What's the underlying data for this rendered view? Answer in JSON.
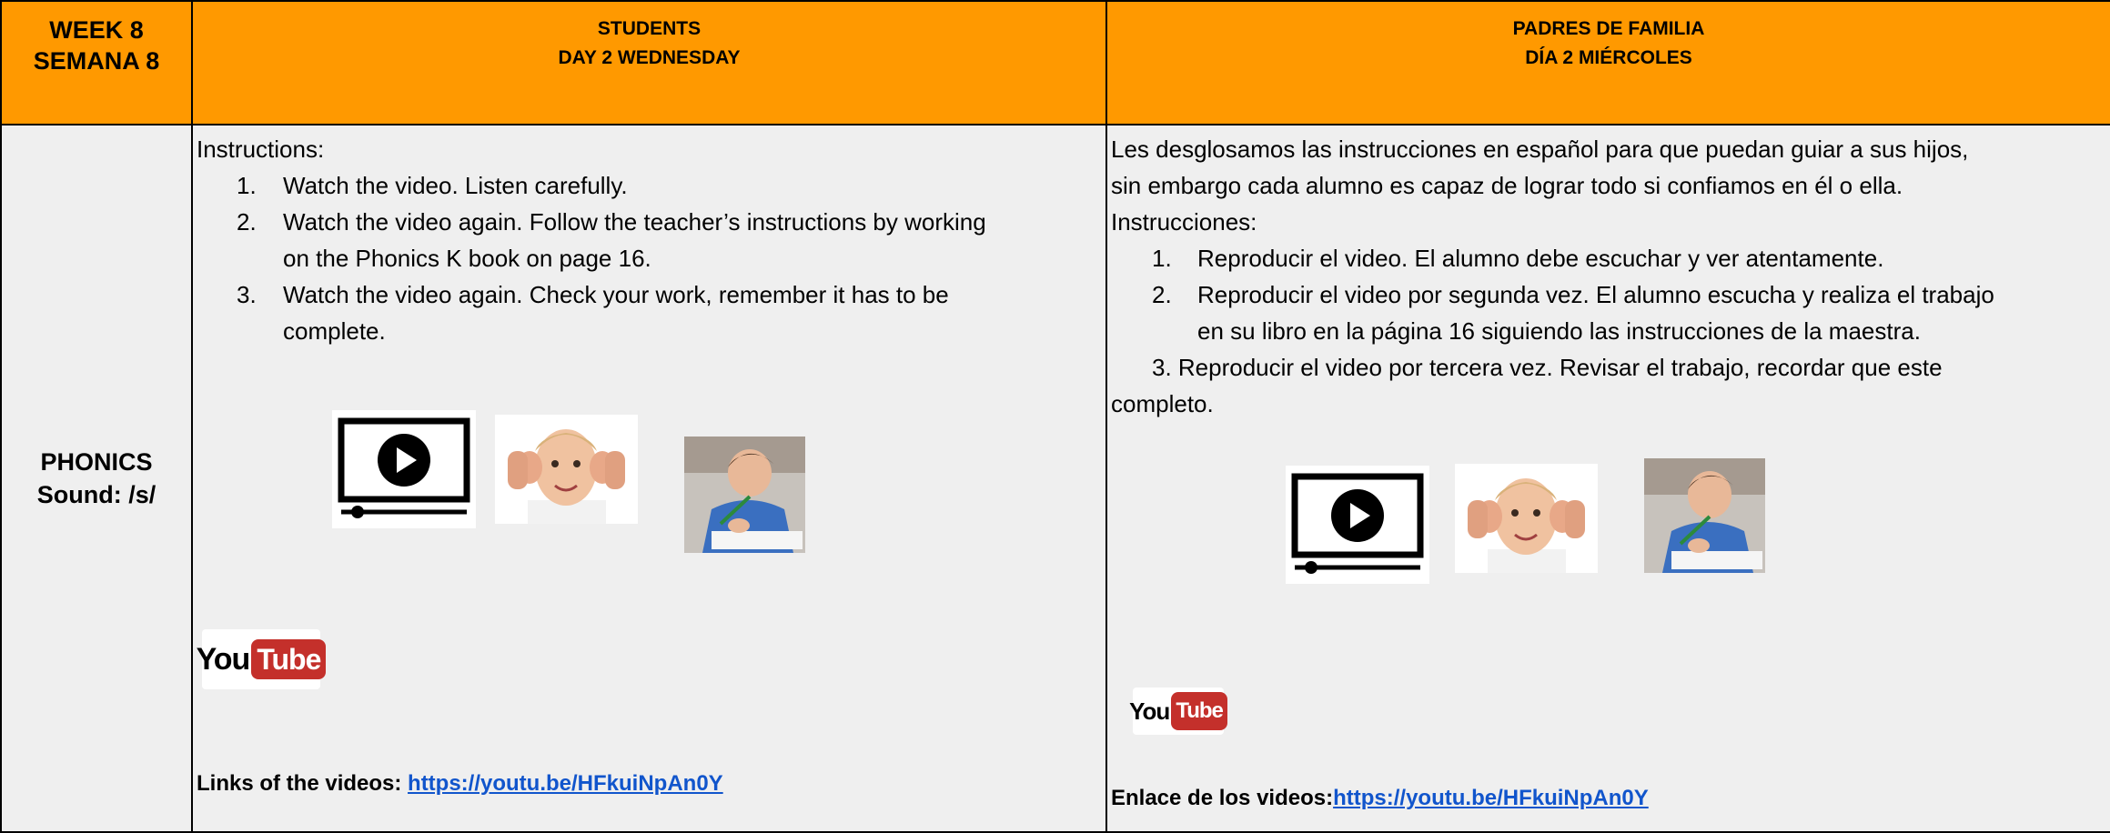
{
  "header": {
    "week_line1": "WEEK 8",
    "week_line2": "SEMANA 8",
    "students_line1": "STUDENTS",
    "students_line2": "DAY 2  WEDNESDAY",
    "parents_line1": "PADRES DE FAMILIA",
    "parents_line2": "DÍA 2 MIÉRCOLES"
  },
  "subject": {
    "line1": "PHONICS",
    "line2": "Sound: /s/"
  },
  "students": {
    "instructions_label": "Instructions:",
    "steps": [
      {
        "num": "1.",
        "line1": "Watch the video. Listen carefully.",
        "line2": ""
      },
      {
        "num": "2.",
        "line1": "Watch the video again. Follow the teacher’s instructions by working",
        "line2": "on the Phonics K book on page 16."
      },
      {
        "num": "3.",
        "line1": "Watch the video again. Check your work, remember it has to be",
        "line2": "complete."
      }
    ],
    "links_label": "Links of the videos: ",
    "link": "https://youtu.be/HFkuiNpAn0Y"
  },
  "parents": {
    "intro_line1": "Les desglosamos las instrucciones en español para que puedan guiar a sus hijos,",
    "intro_line2": "sin embargo cada alumno es capaz de lograr todo si confiamos en él o ella.",
    "instructions_label": "Instrucciones:",
    "step1_num": "1.",
    "step1": "Reproducir el video. El alumno debe escuchar y ver atentamente.",
    "step2_num": "2.",
    "step2_line1": "Reproducir el video por segunda vez. El alumno escucha y realiza el trabajo",
    "step2_line2": "en su libro en la página 16 siguiendo las instrucciones de la maestra.",
    "step3_line1": "3. Reproducir el video por tercera vez. Revisar el trabajo, recordar que este",
    "step3_line2": "completo.",
    "links_label": "Enlace de los videos:",
    "link": "https://youtu.be/HFkuiNpAn0Y"
  },
  "youtube": {
    "you": "You",
    "tube": "Tube"
  },
  "colors": {
    "header_bg": "#ff9900",
    "body_bg": "#efefef",
    "link": "#1155cc",
    "youtube_red": "#c4302b"
  },
  "icons": [
    "video-player-icon",
    "listening-child-icon",
    "writing-child-icon",
    "youtube-logo"
  ]
}
